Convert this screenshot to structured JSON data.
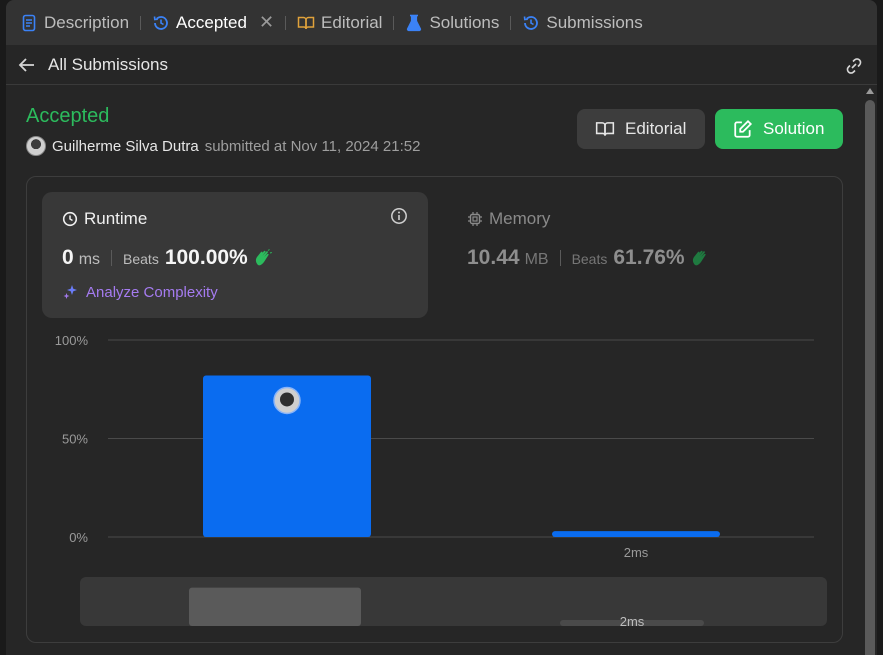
{
  "tabs": [
    {
      "label": "Description",
      "icon": "description-icon"
    },
    {
      "label": "Accepted",
      "icon": "history-icon",
      "active": true,
      "closable": true
    },
    {
      "label": "Editorial",
      "icon": "book-icon"
    },
    {
      "label": "Solutions",
      "icon": "flask-icon"
    },
    {
      "label": "Submissions",
      "icon": "history-icon"
    }
  ],
  "subheader": {
    "back_label": "All Submissions"
  },
  "submission": {
    "status": "Accepted",
    "username": "Guilherme Silva Dutra",
    "submitted_text": "submitted at Nov 11, 2024 21:52"
  },
  "buttons": {
    "editorial": "Editorial",
    "solution": "Solution"
  },
  "runtime": {
    "title": "Runtime",
    "value": "0",
    "unit": "ms",
    "beats_label": "Beats",
    "beats_value": "100.00%",
    "analyze_label": "Analyze Complexity"
  },
  "memory": {
    "title": "Memory",
    "value": "10.44",
    "unit": "MB",
    "beats_label": "Beats",
    "beats_value": "61.76%"
  },
  "colors": {
    "accepted": "#2cbb5d",
    "bar": "#0a6cf0",
    "analyze": "#a57bf0",
    "clap": "#2cbb5d"
  },
  "chart_data": {
    "type": "bar",
    "categories": [
      "",
      "2ms"
    ],
    "values": [
      82,
      3
    ],
    "ylim": [
      0,
      100
    ],
    "yticks": [
      "0%",
      "50%",
      "100%"
    ],
    "grid": true,
    "highlighted_index": 0
  },
  "minimap": {
    "tick_label": "2ms"
  }
}
